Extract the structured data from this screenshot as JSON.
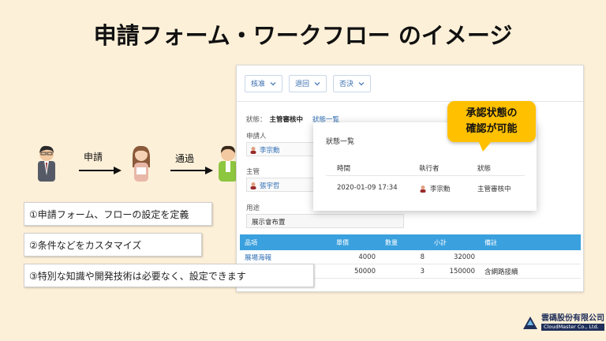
{
  "slide": {
    "title": "申請フォーム・ワークフロー のイメージ"
  },
  "flow": {
    "step1_label": "申請",
    "step2_label": "通過"
  },
  "notes": [
    "①申請フォーム、フローの設定を定義",
    "②条件などをカスタマイズ",
    "③特別な知識や開発技術は必要なく、設定できます"
  ],
  "toolbar": {
    "approve_label": "核准",
    "return_label": "退回",
    "reject_label": "否決"
  },
  "form": {
    "status_label": "狀態：",
    "status_value": "主管審核中",
    "status_link": "狀態一覧",
    "applicant_label": "申請人",
    "applicant_name": "李宗勳",
    "manager_label": "主管",
    "manager_name": "張宇哲",
    "purpose_label": "用途",
    "purpose_value": "展示會布置"
  },
  "table": {
    "headers": [
      "品項",
      "單價",
      "數量",
      "小計",
      "備註"
    ],
    "rows": [
      [
        "展場海報",
        "4000",
        "8",
        "32000",
        ""
      ],
      [
        "",
        "50000",
        "3",
        "150000",
        "含網路接續"
      ]
    ]
  },
  "popup": {
    "title": "狀態一覧",
    "headers": [
      "時間",
      "執行者",
      "狀態"
    ],
    "row": {
      "time": "2020-01-09 17:34",
      "executor": "李宗勳",
      "status": "主管審核中"
    }
  },
  "callout": {
    "line1": "承認状態の",
    "line2": "確認が可能"
  },
  "logo": {
    "jp": "雲碼股份有限公司",
    "en": "CloudMaster Co., Ltd."
  },
  "colors": {
    "background": "#fdf0d8",
    "table_header": "#3aa0de",
    "callout": "#ffc000",
    "link": "#2e6db4"
  }
}
